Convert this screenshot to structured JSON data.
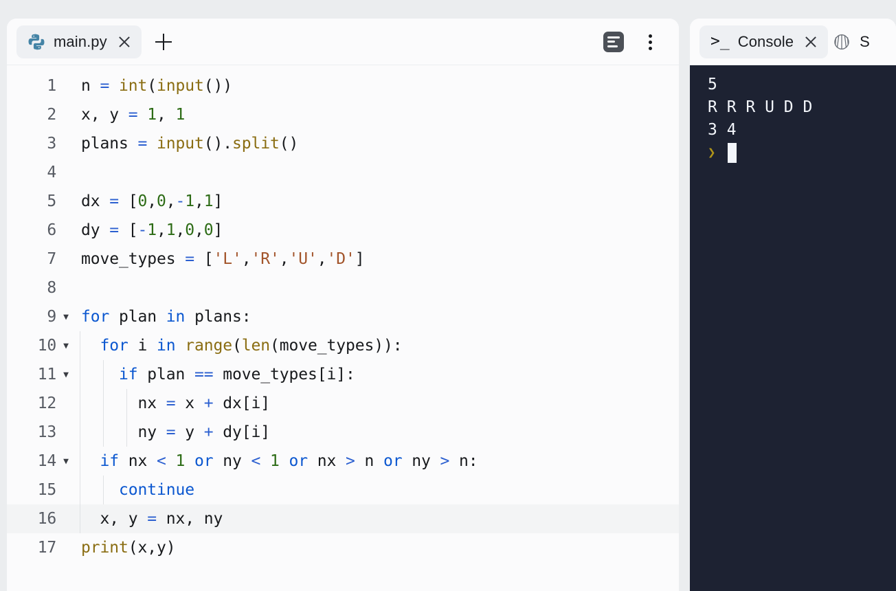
{
  "app": {
    "background": "#ebedef",
    "accent": "#0b57d0"
  },
  "editor": {
    "tab": {
      "icon": "python-icon",
      "label": "main.py",
      "close_icon": "close-icon"
    },
    "new_tab_icon": "plus-icon",
    "actions": [
      {
        "name": "assistant-icon",
        "label": ""
      },
      {
        "name": "kebab-menu-icon",
        "label": ""
      }
    ],
    "active_line": 16,
    "lines": [
      {
        "num": "1",
        "fold": "",
        "indent": 0,
        "tokens": [
          {
            "t": "n",
            "c": "id"
          },
          {
            "t": " ",
            "c": "id"
          },
          {
            "t": "=",
            "c": "op"
          },
          {
            "t": " ",
            "c": "id"
          },
          {
            "t": "int",
            "c": "fn"
          },
          {
            "t": "(",
            "c": "id"
          },
          {
            "t": "input",
            "c": "fn"
          },
          {
            "t": "())",
            "c": "id"
          }
        ]
      },
      {
        "num": "2",
        "fold": "",
        "indent": 0,
        "tokens": [
          {
            "t": "x, y ",
            "c": "id"
          },
          {
            "t": "=",
            "c": "op"
          },
          {
            "t": " ",
            "c": "id"
          },
          {
            "t": "1",
            "c": "num"
          },
          {
            "t": ", ",
            "c": "id"
          },
          {
            "t": "1",
            "c": "num"
          }
        ]
      },
      {
        "num": "3",
        "fold": "",
        "indent": 0,
        "tokens": [
          {
            "t": "plans ",
            "c": "id"
          },
          {
            "t": "=",
            "c": "op"
          },
          {
            "t": " ",
            "c": "id"
          },
          {
            "t": "input",
            "c": "fn"
          },
          {
            "t": "().",
            "c": "id"
          },
          {
            "t": "split",
            "c": "fn"
          },
          {
            "t": "()",
            "c": "id"
          }
        ]
      },
      {
        "num": "4",
        "fold": "",
        "indent": 0,
        "tokens": []
      },
      {
        "num": "5",
        "fold": "",
        "indent": 0,
        "tokens": [
          {
            "t": "dx ",
            "c": "id"
          },
          {
            "t": "=",
            "c": "op"
          },
          {
            "t": " [",
            "c": "id"
          },
          {
            "t": "0",
            "c": "num"
          },
          {
            "t": ",",
            "c": "id"
          },
          {
            "t": "0",
            "c": "num"
          },
          {
            "t": ",",
            "c": "id"
          },
          {
            "t": "-",
            "c": "op"
          },
          {
            "t": "1",
            "c": "num"
          },
          {
            "t": ",",
            "c": "id"
          },
          {
            "t": "1",
            "c": "num"
          },
          {
            "t": "]",
            "c": "id"
          }
        ]
      },
      {
        "num": "6",
        "fold": "",
        "indent": 0,
        "tokens": [
          {
            "t": "dy ",
            "c": "id"
          },
          {
            "t": "=",
            "c": "op"
          },
          {
            "t": " [",
            "c": "id"
          },
          {
            "t": "-",
            "c": "op"
          },
          {
            "t": "1",
            "c": "num"
          },
          {
            "t": ",",
            "c": "id"
          },
          {
            "t": "1",
            "c": "num"
          },
          {
            "t": ",",
            "c": "id"
          },
          {
            "t": "0",
            "c": "num"
          },
          {
            "t": ",",
            "c": "id"
          },
          {
            "t": "0",
            "c": "num"
          },
          {
            "t": "]",
            "c": "id"
          }
        ]
      },
      {
        "num": "7",
        "fold": "",
        "indent": 0,
        "tokens": [
          {
            "t": "move_types ",
            "c": "id"
          },
          {
            "t": "=",
            "c": "op"
          },
          {
            "t": " [",
            "c": "id"
          },
          {
            "t": "'L'",
            "c": "str"
          },
          {
            "t": ",",
            "c": "id"
          },
          {
            "t": "'R'",
            "c": "str"
          },
          {
            "t": ",",
            "c": "id"
          },
          {
            "t": "'U'",
            "c": "str"
          },
          {
            "t": ",",
            "c": "id"
          },
          {
            "t": "'D'",
            "c": "str"
          },
          {
            "t": "]",
            "c": "id"
          }
        ]
      },
      {
        "num": "8",
        "fold": "",
        "indent": 0,
        "tokens": []
      },
      {
        "num": "9",
        "fold": "▼",
        "indent": 0,
        "tokens": [
          {
            "t": "for",
            "c": "kw"
          },
          {
            "t": " plan ",
            "c": "id"
          },
          {
            "t": "in",
            "c": "kw"
          },
          {
            "t": " plans:",
            "c": "id"
          }
        ]
      },
      {
        "num": "10",
        "fold": "▼",
        "indent": 1,
        "tokens": [
          {
            "t": "  ",
            "c": "id"
          },
          {
            "t": "for",
            "c": "kw"
          },
          {
            "t": " i ",
            "c": "id"
          },
          {
            "t": "in",
            "c": "kw"
          },
          {
            "t": " ",
            "c": "id"
          },
          {
            "t": "range",
            "c": "fn"
          },
          {
            "t": "(",
            "c": "id"
          },
          {
            "t": "len",
            "c": "fn"
          },
          {
            "t": "(move_types)):",
            "c": "id"
          }
        ]
      },
      {
        "num": "11",
        "fold": "▼",
        "indent": 2,
        "tokens": [
          {
            "t": "    ",
            "c": "id"
          },
          {
            "t": "if",
            "c": "kw"
          },
          {
            "t": " plan ",
            "c": "id"
          },
          {
            "t": "==",
            "c": "op"
          },
          {
            "t": " move_types[i]:",
            "c": "id"
          }
        ]
      },
      {
        "num": "12",
        "fold": "",
        "indent": 3,
        "tokens": [
          {
            "t": "      nx ",
            "c": "id"
          },
          {
            "t": "=",
            "c": "op"
          },
          {
            "t": " x ",
            "c": "id"
          },
          {
            "t": "+",
            "c": "op"
          },
          {
            "t": " dx[i]",
            "c": "id"
          }
        ]
      },
      {
        "num": "13",
        "fold": "",
        "indent": 3,
        "tokens": [
          {
            "t": "      ny ",
            "c": "id"
          },
          {
            "t": "=",
            "c": "op"
          },
          {
            "t": " y ",
            "c": "id"
          },
          {
            "t": "+",
            "c": "op"
          },
          {
            "t": " dy[i]",
            "c": "id"
          }
        ]
      },
      {
        "num": "14",
        "fold": "▼",
        "indent": 1,
        "tokens": [
          {
            "t": "  ",
            "c": "id"
          },
          {
            "t": "if",
            "c": "kw"
          },
          {
            "t": " nx ",
            "c": "id"
          },
          {
            "t": "<",
            "c": "op"
          },
          {
            "t": " ",
            "c": "id"
          },
          {
            "t": "1",
            "c": "num"
          },
          {
            "t": " ",
            "c": "id"
          },
          {
            "t": "or",
            "c": "kw"
          },
          {
            "t": " ny ",
            "c": "id"
          },
          {
            "t": "<",
            "c": "op"
          },
          {
            "t": " ",
            "c": "id"
          },
          {
            "t": "1",
            "c": "num"
          },
          {
            "t": " ",
            "c": "id"
          },
          {
            "t": "or",
            "c": "kw"
          },
          {
            "t": " nx ",
            "c": "id"
          },
          {
            "t": ">",
            "c": "op"
          },
          {
            "t": " n ",
            "c": "id"
          },
          {
            "t": "or",
            "c": "kw"
          },
          {
            "t": " ny ",
            "c": "id"
          },
          {
            "t": ">",
            "c": "op"
          },
          {
            "t": " n:",
            "c": "id"
          }
        ]
      },
      {
        "num": "15",
        "fold": "",
        "indent": 2,
        "tokens": [
          {
            "t": "    ",
            "c": "id"
          },
          {
            "t": "continue",
            "c": "kw"
          }
        ]
      },
      {
        "num": "16",
        "fold": "",
        "indent": 1,
        "tokens": [
          {
            "t": "  x, y ",
            "c": "id"
          },
          {
            "t": "=",
            "c": "op"
          },
          {
            "t": " nx, ny",
            "c": "id"
          }
        ]
      },
      {
        "num": "17",
        "fold": "",
        "indent": 0,
        "tokens": [
          {
            "t": "print",
            "c": "fn"
          },
          {
            "t": "(x,y)",
            "c": "id"
          }
        ]
      }
    ]
  },
  "console": {
    "tab": {
      "icon": "terminal-prompt-icon",
      "icon_glyph": ">_",
      "label": "Console",
      "close_icon": "close-icon"
    },
    "shell_tab": {
      "icon": "shell-icon",
      "label": "S"
    },
    "background": "#1d2232",
    "prompt_glyph": "❯",
    "output": [
      {
        "text": "5",
        "type": "output"
      },
      {
        "text": "R R R U D D",
        "type": "output"
      },
      {
        "text": "3 4",
        "type": "output"
      },
      {
        "text": "",
        "type": "prompt"
      }
    ]
  }
}
